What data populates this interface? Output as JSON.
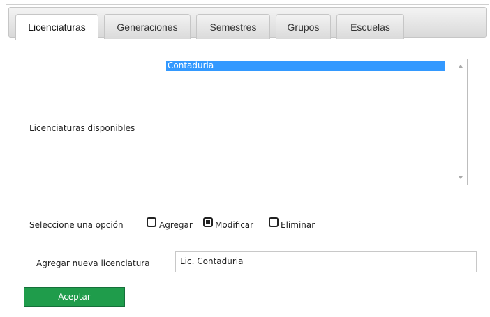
{
  "tabs": [
    {
      "label": "Licenciaturas",
      "active": true
    },
    {
      "label": "Generaciones",
      "active": false
    },
    {
      "label": "Semestres",
      "active": false
    },
    {
      "label": "Grupos",
      "active": false
    },
    {
      "label": "Escuelas",
      "active": false
    }
  ],
  "form": {
    "available_label": "Licenciaturas disponibles",
    "list_options": [
      "Contaduria"
    ],
    "selected_option": "Contaduria",
    "choose_label": "Seleccione una opción",
    "options": [
      {
        "label": "Agregar",
        "checked": false
      },
      {
        "label": "Modificar",
        "checked": true
      },
      {
        "label": "Eliminar",
        "checked": false
      }
    ],
    "new_label": "Agregar nueva licenciatura",
    "new_value": "Lic. Contaduria",
    "submit_label": "Aceptar"
  },
  "colors": {
    "selection": "#3399ff",
    "button": "#1f9c4b"
  },
  "icons": [
    "scroll-up-icon",
    "scroll-down-icon",
    "checkbox-icon"
  ]
}
